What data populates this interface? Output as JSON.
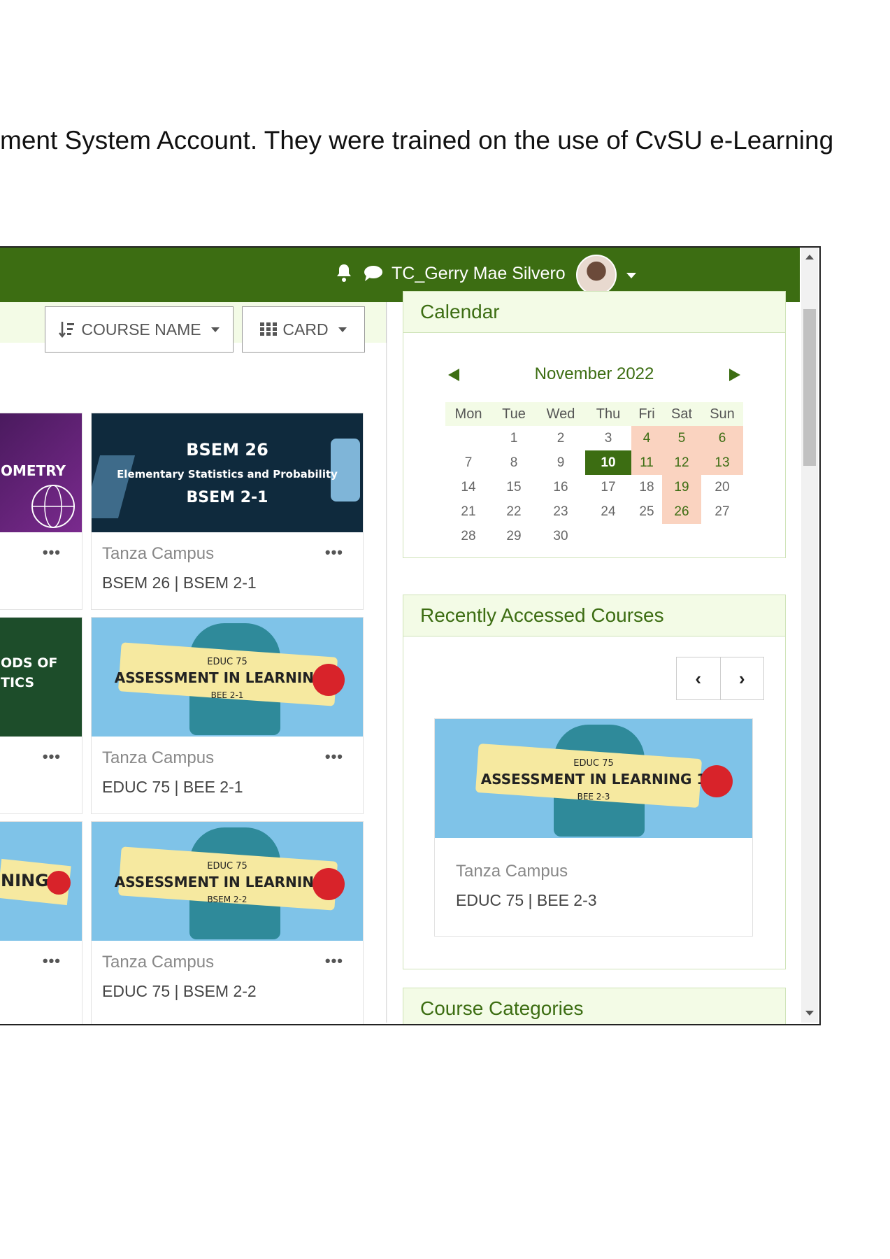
{
  "document_text": "ment System Account. They were trained on the use of CvSU e-Learning",
  "topbar": {
    "username": "TC_Gerry Mae Silvero"
  },
  "toolbar": {
    "sort_label": "COURSE NAME",
    "view_label": "CARD"
  },
  "courses": [
    {
      "banner_code": "BSEM 26",
      "banner_title": "Elementary Statistics and Probability",
      "banner_section": "BSEM 2-1",
      "campus": "Tanza Campus",
      "name": "BSEM 26 | BSEM 2-1",
      "more": "•••"
    },
    {
      "banner_code": "EDUC 75",
      "banner_title": "ASSESSMENT IN LEARNING 1",
      "banner_section": "BEE 2-1",
      "campus": "Tanza Campus",
      "name": "EDUC 75 | BEE 2-1",
      "more": "•••"
    },
    {
      "banner_code": "EDUC 75",
      "banner_title": "ASSESSMENT IN LEARNING 1",
      "banner_section": "BSEM 2-2",
      "campus": "Tanza Campus",
      "name": "EDUC 75 | BSEM 2-2",
      "more": "•••"
    }
  ],
  "partial_courses": [
    {
      "banner_text": "OMETRY",
      "more": "•••"
    },
    {
      "banner_text_1": "ODS OF",
      "banner_text_2": "TICS",
      "more": "•••"
    },
    {
      "banner_text": "NING 1",
      "more": "•••"
    }
  ],
  "calendar": {
    "title": "Calendar",
    "month": "November 2022",
    "weekdays": [
      "Mon",
      "Tue",
      "Wed",
      "Thu",
      "Fri",
      "Sat",
      "Sun"
    ],
    "weeks": [
      [
        "",
        "1",
        "2",
        "3",
        "4",
        "5",
        "6"
      ],
      [
        "7",
        "8",
        "9",
        "10",
        "11",
        "12",
        "13"
      ],
      [
        "14",
        "15",
        "16",
        "17",
        "18",
        "19",
        "20"
      ],
      [
        "21",
        "22",
        "23",
        "24",
        "25",
        "26",
        "27"
      ],
      [
        "28",
        "29",
        "30",
        "",
        "",
        "",
        ""
      ]
    ],
    "today": "10"
  },
  "recent": {
    "title": "Recently Accessed Courses",
    "prev": "‹",
    "next": "›",
    "course": {
      "banner_code": "EDUC 75",
      "banner_title": "ASSESSMENT IN LEARNING 1",
      "banner_section": "BEE 2-3",
      "campus": "Tanza Campus",
      "name": "EDUC 75 | BEE 2-3"
    }
  },
  "categories": {
    "title": "Course Categories"
  },
  "colors": {
    "brand": "#3c6d12",
    "weekend": "#fad3c0",
    "block_header": "#f3fbe6"
  }
}
